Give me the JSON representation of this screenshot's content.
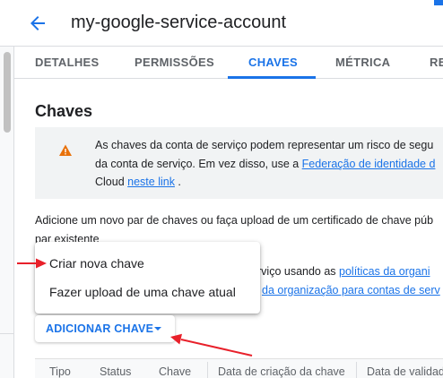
{
  "header": {
    "title": "my-google-service-account",
    "back_icon": "arrow-back-icon"
  },
  "tabs": [
    {
      "label": "DETALHES",
      "active": false
    },
    {
      "label": "PERMISSÕES",
      "active": false
    },
    {
      "label": "CHAVES",
      "active": true
    },
    {
      "label": "MÉTRICA",
      "active": false
    },
    {
      "label": "RE",
      "active": false
    }
  ],
  "section": {
    "title": "Chaves"
  },
  "warning": {
    "icon": "warning-icon",
    "line1": "As chaves da conta de serviço podem representar um risco de segu",
    "line2_prefix": "da conta de serviço. Em vez disso, use a ",
    "line2_link": "Federação de identidade d",
    "line3_prefix": "Cloud ",
    "line3_link": "neste link",
    "line3_suffix": " ."
  },
  "description": {
    "line1": "Adicione um novo par de chaves ou faça upload de um certificado de chave púb",
    "line2": "par existente"
  },
  "policy_text": {
    "line1_prefix": "rviço usando as ",
    "line1_link": "políticas da organi",
    "line2_link": "da organização para contas de serv"
  },
  "menu": {
    "items": [
      "Criar nova chave",
      "Fazer upload de uma chave atual"
    ]
  },
  "add_button": {
    "label": "ADICIONAR CHAVE",
    "icon": "caret-down-icon"
  },
  "table": {
    "headers": [
      "Tipo",
      "Status",
      "Chave",
      "Data de criação da chave",
      "Data de validade"
    ]
  },
  "colors": {
    "accent": "#1a73e8",
    "warning": "#e8710a",
    "annotation": "#e8202a"
  }
}
